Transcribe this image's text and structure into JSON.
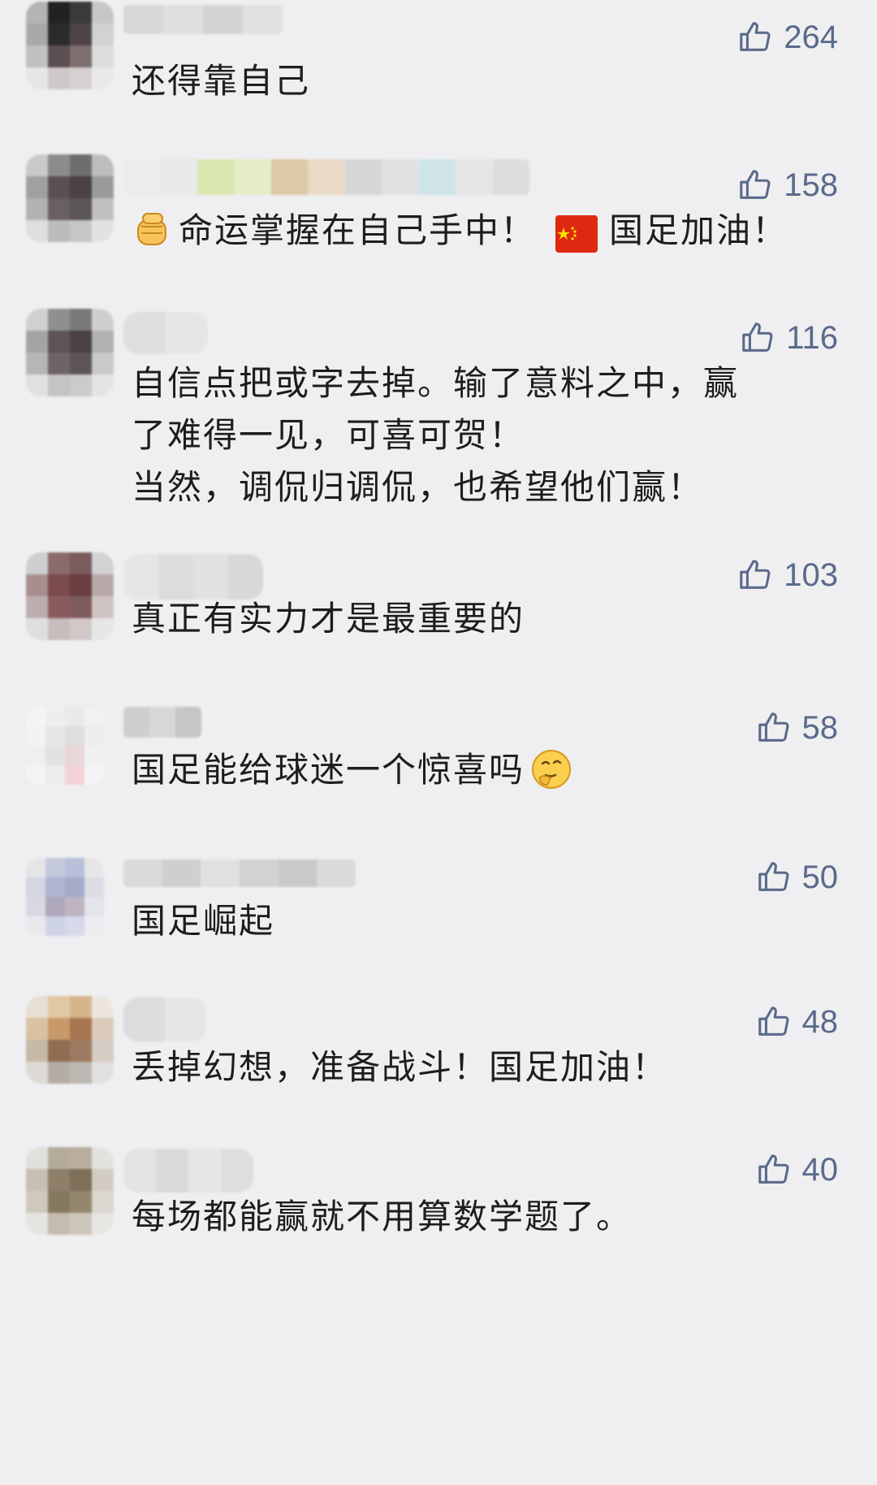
{
  "comments": [
    {
      "likes": "264",
      "text": [
        "还得靠自己"
      ]
    },
    {
      "likes": "158",
      "text_a": "命运掌握在自己手中！",
      "text_b": "国足加油！",
      "emoji_a": "raised-fist-icon",
      "emoji_b": "china-flag-icon"
    },
    {
      "likes": "116",
      "text": [
        "自信点把或字去掉。输了意料之中，赢",
        "了难得一见，可喜可贺！",
        "当然，调侃归调侃，也希望他们赢！"
      ]
    },
    {
      "likes": "103",
      "text": [
        "真正有实力才是最重要的"
      ]
    },
    {
      "likes": "58",
      "text_a": "国足能给球迷一个惊喜吗",
      "emoji": "thinking-face-icon"
    },
    {
      "likes": "50",
      "text": [
        "国足崛起"
      ]
    },
    {
      "likes": "48",
      "text": [
        "丢掉幻想，准备战斗！国足加油！"
      ]
    },
    {
      "likes": "40",
      "text": [
        "每场都能赢就不用算数学题了。"
      ]
    }
  ],
  "colors": {
    "background": "#efeff1",
    "like_color": "#5a6a8a",
    "text_color": "#1d1d1d"
  },
  "icons": {
    "like": "thumbs-up-icon"
  }
}
